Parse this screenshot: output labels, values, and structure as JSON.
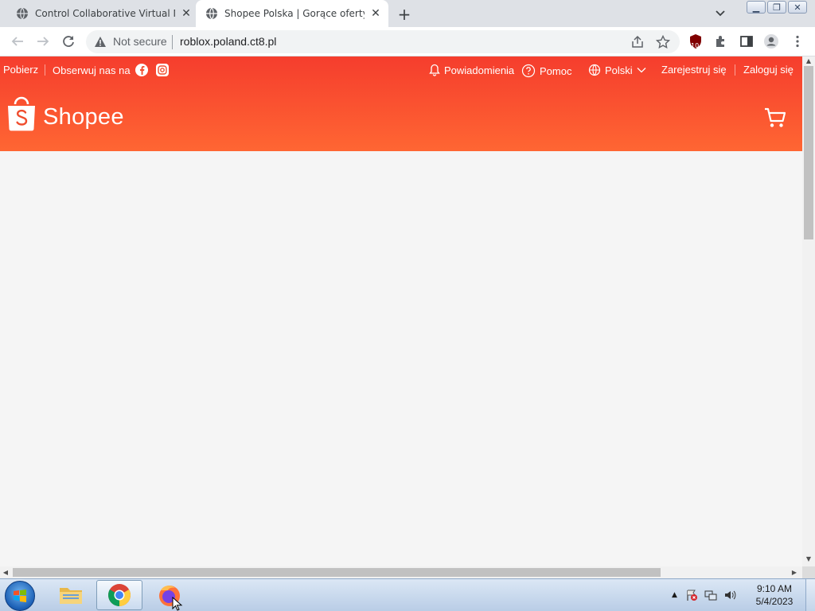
{
  "browser": {
    "tabs": [
      {
        "title": "Control Collaborative Virtual Mac",
        "active": false
      },
      {
        "title": "Shopee Polska | Gorące oferty, na",
        "active": true
      }
    ],
    "new_tab_label": "+",
    "address": {
      "security_label": "Not secure",
      "url": "roblox.poland.ct8.pl"
    },
    "extension_badge": "10"
  },
  "shopee": {
    "topnav": {
      "download": "Pobierz",
      "follow": "Obserwuj nas na",
      "notifications": "Powiadomienia",
      "help": "Pomoc",
      "language": "Polski",
      "register": "Zarejestruj się",
      "login": "Zaloguj się"
    },
    "logo_text": "Shopee",
    "colors": {
      "brand_top": "#f53d2d",
      "brand_bottom": "#ff6633",
      "page_bg": "#f5f5f5"
    }
  },
  "taskbar": {
    "apps": [
      "windows-explorer",
      "google-chrome",
      "firefox"
    ],
    "clock": {
      "time": "9:10 AM",
      "date": "5/4/2023"
    }
  }
}
